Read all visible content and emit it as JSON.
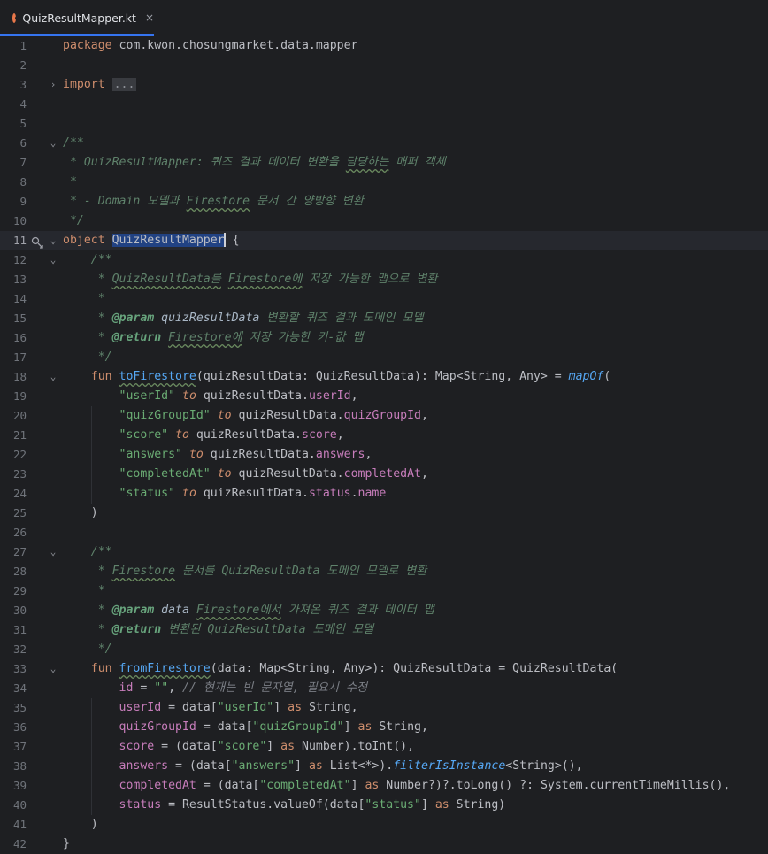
{
  "tab": {
    "filename": "QuizResultMapper.kt",
    "close_glyph": "×",
    "icon": "kotlin-file-icon"
  },
  "editor": {
    "current_line": 11,
    "lines": [
      {
        "n": "1",
        "segs": [
          [
            "kw",
            "package "
          ],
          [
            "plain",
            "com.kwon.chosungmarket.data.mapper"
          ]
        ]
      },
      {
        "n": "2",
        "segs": []
      },
      {
        "n": "3",
        "fold": "›",
        "segs": [
          [
            "kw",
            "import "
          ],
          [
            "foldbox",
            "..."
          ]
        ]
      },
      {
        "n": "4",
        "segs": []
      },
      {
        "n": "5",
        "segs": []
      },
      {
        "n": "6",
        "fold": "⌄",
        "segs": [
          [
            "doc",
            "/**"
          ]
        ]
      },
      {
        "n": "7",
        "segs": [
          [
            "doc",
            " * QuizResultMapper: 퀴즈 결과 데이터 변환을 "
          ],
          [
            "doctypo",
            "담당하는"
          ],
          [
            "doc",
            " 매퍼 객체"
          ]
        ]
      },
      {
        "n": "8",
        "segs": [
          [
            "doc",
            " *"
          ]
        ]
      },
      {
        "n": "9",
        "segs": [
          [
            "doc",
            " * - Domain 모델과 "
          ],
          [
            "doctypo",
            "Firestore"
          ],
          [
            "doc",
            " 문서 간 양방향 변환"
          ]
        ]
      },
      {
        "n": "10",
        "segs": [
          [
            "doc",
            " */"
          ]
        ]
      },
      {
        "n": "11",
        "fold": "⌄",
        "icon": true,
        "segs": [
          [
            "kw",
            "object "
          ],
          [
            "sel",
            "QuizResultMapper"
          ],
          [
            "caret",
            ""
          ],
          [
            "plain",
            " {"
          ]
        ]
      },
      {
        "n": "12",
        "fold": "⌄",
        "segs": [
          [
            "doc",
            "    /**"
          ]
        ]
      },
      {
        "n": "13",
        "segs": [
          [
            "doc",
            "     * "
          ],
          [
            "doctypo",
            "QuizResultData를"
          ],
          [
            "doc",
            " "
          ],
          [
            "doctypo",
            "Firestore에"
          ],
          [
            "doc",
            " 저장 가능한 맵으로 변환"
          ]
        ]
      },
      {
        "n": "14",
        "segs": [
          [
            "doc",
            "     *"
          ]
        ]
      },
      {
        "n": "15",
        "segs": [
          [
            "doc",
            "     * "
          ],
          [
            "tag",
            "@param"
          ],
          [
            "doc",
            " "
          ],
          [
            "pname",
            "quizResultData"
          ],
          [
            "doc",
            " 변환할 퀴즈 결과 도메인 모델"
          ]
        ]
      },
      {
        "n": "16",
        "segs": [
          [
            "doc",
            "     * "
          ],
          [
            "tag",
            "@return"
          ],
          [
            "doc",
            " "
          ],
          [
            "doctypo",
            "Firestore에"
          ],
          [
            "doc",
            " 저장 가능한 키-값 맵"
          ]
        ]
      },
      {
        "n": "17",
        "segs": [
          [
            "doc",
            "     */"
          ]
        ]
      },
      {
        "n": "18",
        "fold": "⌄",
        "segs": [
          [
            "plain",
            "    "
          ],
          [
            "kw",
            "fun "
          ],
          [
            "fntypo",
            "toFirestore"
          ],
          [
            "plain",
            "(quizResultData: QuizResultData): Map<String, Any> = "
          ],
          [
            "itf",
            "mapOf"
          ],
          [
            "plain",
            "("
          ]
        ]
      },
      {
        "n": "19",
        "segs": [
          [
            "plain",
            "        "
          ],
          [
            "str",
            "\"userId\""
          ],
          [
            "plain",
            " "
          ],
          [
            "kwi",
            "to"
          ],
          [
            "plain",
            " quizResultData."
          ],
          [
            "prop",
            "userId"
          ],
          [
            "plain",
            ","
          ]
        ]
      },
      {
        "n": "20",
        "segs": [
          [
            "plain",
            "        "
          ],
          [
            "str",
            "\"quizGroupId\""
          ],
          [
            "plain",
            " "
          ],
          [
            "kwi",
            "to"
          ],
          [
            "plain",
            " quizResultData."
          ],
          [
            "prop",
            "quizGroupId"
          ],
          [
            "plain",
            ","
          ]
        ]
      },
      {
        "n": "21",
        "segs": [
          [
            "plain",
            "        "
          ],
          [
            "str",
            "\"score\""
          ],
          [
            "plain",
            " "
          ],
          [
            "kwi",
            "to"
          ],
          [
            "plain",
            " quizResultData."
          ],
          [
            "prop",
            "score"
          ],
          [
            "plain",
            ","
          ]
        ]
      },
      {
        "n": "22",
        "segs": [
          [
            "plain",
            "        "
          ],
          [
            "str",
            "\"answers\""
          ],
          [
            "plain",
            " "
          ],
          [
            "kwi",
            "to"
          ],
          [
            "plain",
            " quizResultData."
          ],
          [
            "prop",
            "answers"
          ],
          [
            "plain",
            ","
          ]
        ]
      },
      {
        "n": "23",
        "segs": [
          [
            "plain",
            "        "
          ],
          [
            "str",
            "\"completedAt\""
          ],
          [
            "plain",
            " "
          ],
          [
            "kwi",
            "to"
          ],
          [
            "plain",
            " quizResultData."
          ],
          [
            "prop",
            "completedAt"
          ],
          [
            "plain",
            ","
          ]
        ]
      },
      {
        "n": "24",
        "segs": [
          [
            "plain",
            "        "
          ],
          [
            "str",
            "\"status\""
          ],
          [
            "plain",
            " "
          ],
          [
            "kwi",
            "to"
          ],
          [
            "plain",
            " quizResultData."
          ],
          [
            "prop",
            "status"
          ],
          [
            "plain",
            "."
          ],
          [
            "prop",
            "name"
          ]
        ]
      },
      {
        "n": "25",
        "segs": [
          [
            "plain",
            "    )"
          ]
        ]
      },
      {
        "n": "26",
        "segs": []
      },
      {
        "n": "27",
        "fold": "⌄",
        "segs": [
          [
            "doc",
            "    /**"
          ]
        ]
      },
      {
        "n": "28",
        "segs": [
          [
            "doc",
            "     * "
          ],
          [
            "doctypo",
            "Firestore"
          ],
          [
            "doc",
            " 문서를 QuizResultData 도메인 모델로 변환"
          ]
        ]
      },
      {
        "n": "29",
        "segs": [
          [
            "doc",
            "     *"
          ]
        ]
      },
      {
        "n": "30",
        "segs": [
          [
            "doc",
            "     * "
          ],
          [
            "tag",
            "@param"
          ],
          [
            "doc",
            " "
          ],
          [
            "pname",
            "data"
          ],
          [
            "doc",
            " "
          ],
          [
            "doctypo",
            "Firestore에서"
          ],
          [
            "doc",
            " 가져온 퀴즈 결과 데이터 맵"
          ]
        ]
      },
      {
        "n": "31",
        "segs": [
          [
            "doc",
            "     * "
          ],
          [
            "tag",
            "@return"
          ],
          [
            "doc",
            " 변환된 QuizResultData 도메인 모델"
          ]
        ]
      },
      {
        "n": "32",
        "segs": [
          [
            "doc",
            "     */"
          ]
        ]
      },
      {
        "n": "33",
        "fold": "⌄",
        "segs": [
          [
            "plain",
            "    "
          ],
          [
            "kw",
            "fun "
          ],
          [
            "fntypo",
            "fromFirestore"
          ],
          [
            "plain",
            "(data: Map<String, Any>): QuizResultData = QuizResultData("
          ]
        ]
      },
      {
        "n": "34",
        "segs": [
          [
            "plain",
            "        "
          ],
          [
            "prop",
            "id"
          ],
          [
            "plain",
            " = "
          ],
          [
            "str",
            "\"\""
          ],
          [
            "plain",
            ", "
          ],
          [
            "cmt",
            "// 현재는 빈 문자열, 필요시 수정"
          ]
        ]
      },
      {
        "n": "35",
        "segs": [
          [
            "plain",
            "        "
          ],
          [
            "prop",
            "userId"
          ],
          [
            "plain",
            " = data["
          ],
          [
            "str",
            "\"userId\""
          ],
          [
            "plain",
            "] "
          ],
          [
            "kw",
            "as"
          ],
          [
            "plain",
            " String,"
          ]
        ]
      },
      {
        "n": "36",
        "segs": [
          [
            "plain",
            "        "
          ],
          [
            "prop",
            "quizGroupId"
          ],
          [
            "plain",
            " = data["
          ],
          [
            "str",
            "\"quizGroupId\""
          ],
          [
            "plain",
            "] "
          ],
          [
            "kw",
            "as"
          ],
          [
            "plain",
            " String,"
          ]
        ]
      },
      {
        "n": "37",
        "segs": [
          [
            "plain",
            "        "
          ],
          [
            "prop",
            "score"
          ],
          [
            "plain",
            " = (data["
          ],
          [
            "str",
            "\"score\""
          ],
          [
            "plain",
            "] "
          ],
          [
            "kw",
            "as"
          ],
          [
            "plain",
            " Number).toInt(),"
          ]
        ]
      },
      {
        "n": "38",
        "segs": [
          [
            "plain",
            "        "
          ],
          [
            "prop",
            "answers"
          ],
          [
            "plain",
            " = (data["
          ],
          [
            "str",
            "\"answers\""
          ],
          [
            "plain",
            "] "
          ],
          [
            "kw",
            "as"
          ],
          [
            "plain",
            " List<*>)."
          ],
          [
            "itf",
            "filterIsInstance"
          ],
          [
            "plain",
            "<String>(),"
          ]
        ]
      },
      {
        "n": "39",
        "segs": [
          [
            "plain",
            "        "
          ],
          [
            "prop",
            "completedAt"
          ],
          [
            "plain",
            " = (data["
          ],
          [
            "str",
            "\"completedAt\""
          ],
          [
            "plain",
            "] "
          ],
          [
            "kw",
            "as"
          ],
          [
            "plain",
            " Number?)?.toLong() ?: System.currentTimeMillis(),"
          ]
        ]
      },
      {
        "n": "40",
        "segs": [
          [
            "plain",
            "        "
          ],
          [
            "prop",
            "status"
          ],
          [
            "plain",
            " = ResultStatus.valueOf(data["
          ],
          [
            "str",
            "\"status\""
          ],
          [
            "plain",
            "] "
          ],
          [
            "kw",
            "as"
          ],
          [
            "plain",
            " String)"
          ]
        ]
      },
      {
        "n": "41",
        "segs": [
          [
            "plain",
            "    )"
          ]
        ]
      },
      {
        "n": "42",
        "segs": [
          [
            "plain",
            "}"
          ]
        ]
      }
    ]
  },
  "colors": {
    "background": "#1e1f22",
    "keyword": "#cf8e6d",
    "string": "#6aab73",
    "property": "#c77dbb",
    "function": "#56a8f5",
    "doc_comment": "#5f826b",
    "selection": "#214283",
    "tab_accent": "#3574f0"
  }
}
